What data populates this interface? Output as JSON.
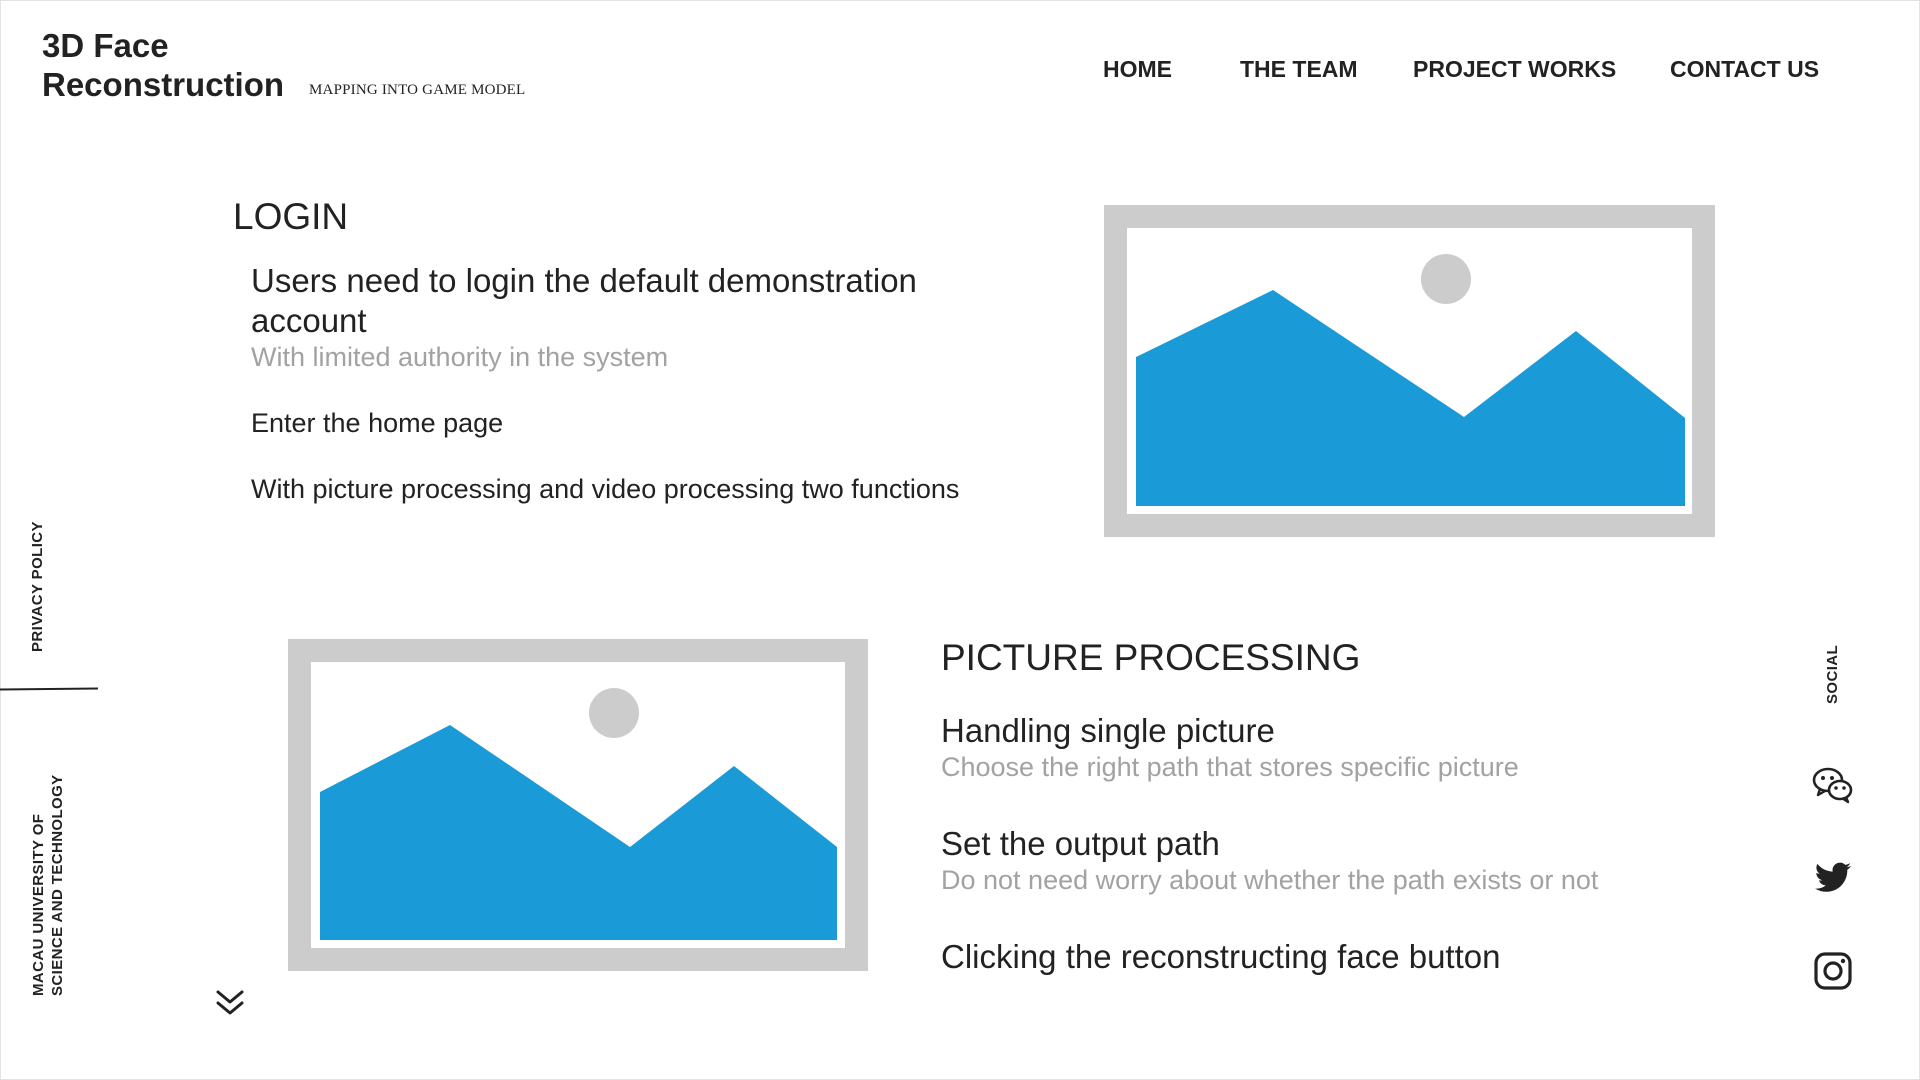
{
  "brand": {
    "title_line1": "3D Face",
    "title_line2": "Reconstruction",
    "tagline": "MAPPING INTO GAME MODEL"
  },
  "nav": {
    "items": [
      {
        "label": "HOME"
      },
      {
        "label": "THE TEAM"
      },
      {
        "label": "PROJECT WORKS"
      },
      {
        "label": "CONTACT US"
      }
    ]
  },
  "sidebar": {
    "privacy": "PRIVACY POLICY",
    "university_line1": "MACAU UNIVERSITY OF",
    "university_line2": "SCIENCE AND TECHNOLOGY"
  },
  "login": {
    "heading": "LOGIN",
    "main_line1": "Users need to login the default demonstration",
    "main_line2": "account",
    "sub": "With limited authority in the system",
    "step2": "Enter the home page",
    "step3": "With picture processing and video processing two functions"
  },
  "picture_processing": {
    "heading": "PICTURE PROCESSING",
    "items": [
      {
        "title": "Handling single picture",
        "sub": "Choose the right path that stores specific picture"
      },
      {
        "title": "Set the output path",
        "sub": "Do not need worry about whether the path exists or not"
      },
      {
        "title": "Clicking the reconstructing face button",
        "sub": ""
      }
    ]
  },
  "social": {
    "label": "SOCIAL",
    "icons": [
      "wechat-icon",
      "twitter-icon",
      "instagram-icon"
    ]
  },
  "colors": {
    "placeholder_frame": "#cccccc",
    "mountain": "#1a9bd7",
    "sun": "#cccccc",
    "muted_text": "#a2a2a2"
  }
}
